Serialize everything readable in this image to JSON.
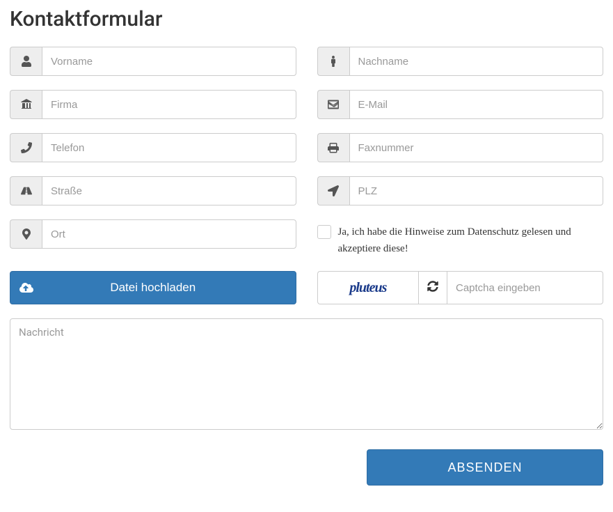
{
  "title": "Kontaktformular",
  "fields": {
    "vorname": {
      "placeholder": "Vorname"
    },
    "nachname": {
      "placeholder": "Nachname"
    },
    "firma": {
      "placeholder": "Firma"
    },
    "email": {
      "placeholder": "E-Mail"
    },
    "telefon": {
      "placeholder": "Telefon"
    },
    "fax": {
      "placeholder": "Faxnummer"
    },
    "strasse": {
      "placeholder": "Straße"
    },
    "plz": {
      "placeholder": "PLZ"
    },
    "ort": {
      "placeholder": "Ort"
    }
  },
  "privacy_label": "Ja, ich habe die Hinweise zum Datenschutz gelesen und akzeptiere diese!",
  "upload_label": "Datei hochladen",
  "captcha": {
    "text": "pluteus",
    "placeholder": "Captcha eingeben"
  },
  "message_placeholder": "Nachricht",
  "submit_label": "ABSENDEN"
}
